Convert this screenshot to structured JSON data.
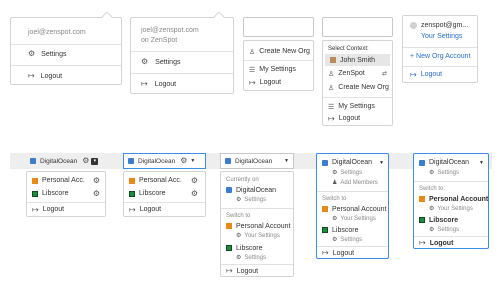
{
  "m1": {
    "email": "joel@zenspot.com",
    "settings": "Settings",
    "logout": "Logout"
  },
  "m2": {
    "email": "joel@zenspot.com",
    "sub": "on ZenSpot",
    "settings": "Settings",
    "logout": "Logout"
  },
  "m3": {
    "create": "Create New Org",
    "my_settings": "My Settings",
    "logout": "Logout"
  },
  "m4": {
    "context_label": "Select Context:",
    "user": "John Smith",
    "org": "ZenSpot",
    "create": "Create New Org",
    "my_settings": "My Settings",
    "logout": "Logout"
  },
  "m5": {
    "email": "zenspot@gm...",
    "settings": "Your Settings",
    "new_org": "+ New Org Account",
    "logout": "Logout"
  },
  "b1": {
    "org": "DigitalOcean",
    "items": [
      "Personal Acc.",
      "Libscore"
    ],
    "logout": "Logout"
  },
  "b2": {
    "org": "DigitalOcean",
    "items": [
      "Personal Acc.",
      "Libscore"
    ],
    "logout": "Logout"
  },
  "b3": {
    "org": "DigitalOcean",
    "currently_on": "Currently on",
    "current": "DigitalOcean",
    "settings": "Settings",
    "switch_to": "Switch to",
    "acct1": "Personal Account",
    "acct1_sub": "Your Settings",
    "acct2": "Libscore",
    "acct2_sub": "Settings",
    "logout": "Logout"
  },
  "b4": {
    "org": "DigitalOcean",
    "settings": "Settings",
    "add_members": "Add Members",
    "switch_to": "Switch to",
    "acct1": "Personal Account",
    "acct1_sub": "Your Settings",
    "acct2": "Libscore",
    "acct2_sub": "Settings",
    "logout": "Logout"
  },
  "b5": {
    "org": "DigitalOcean",
    "settings": "Settings",
    "switch_to": "Switch to:",
    "acct1": "Personal Account",
    "acct1_sub": "Your Settings",
    "acct2": "Libscore",
    "acct2_sub": "Settings",
    "logout": "Logout"
  }
}
